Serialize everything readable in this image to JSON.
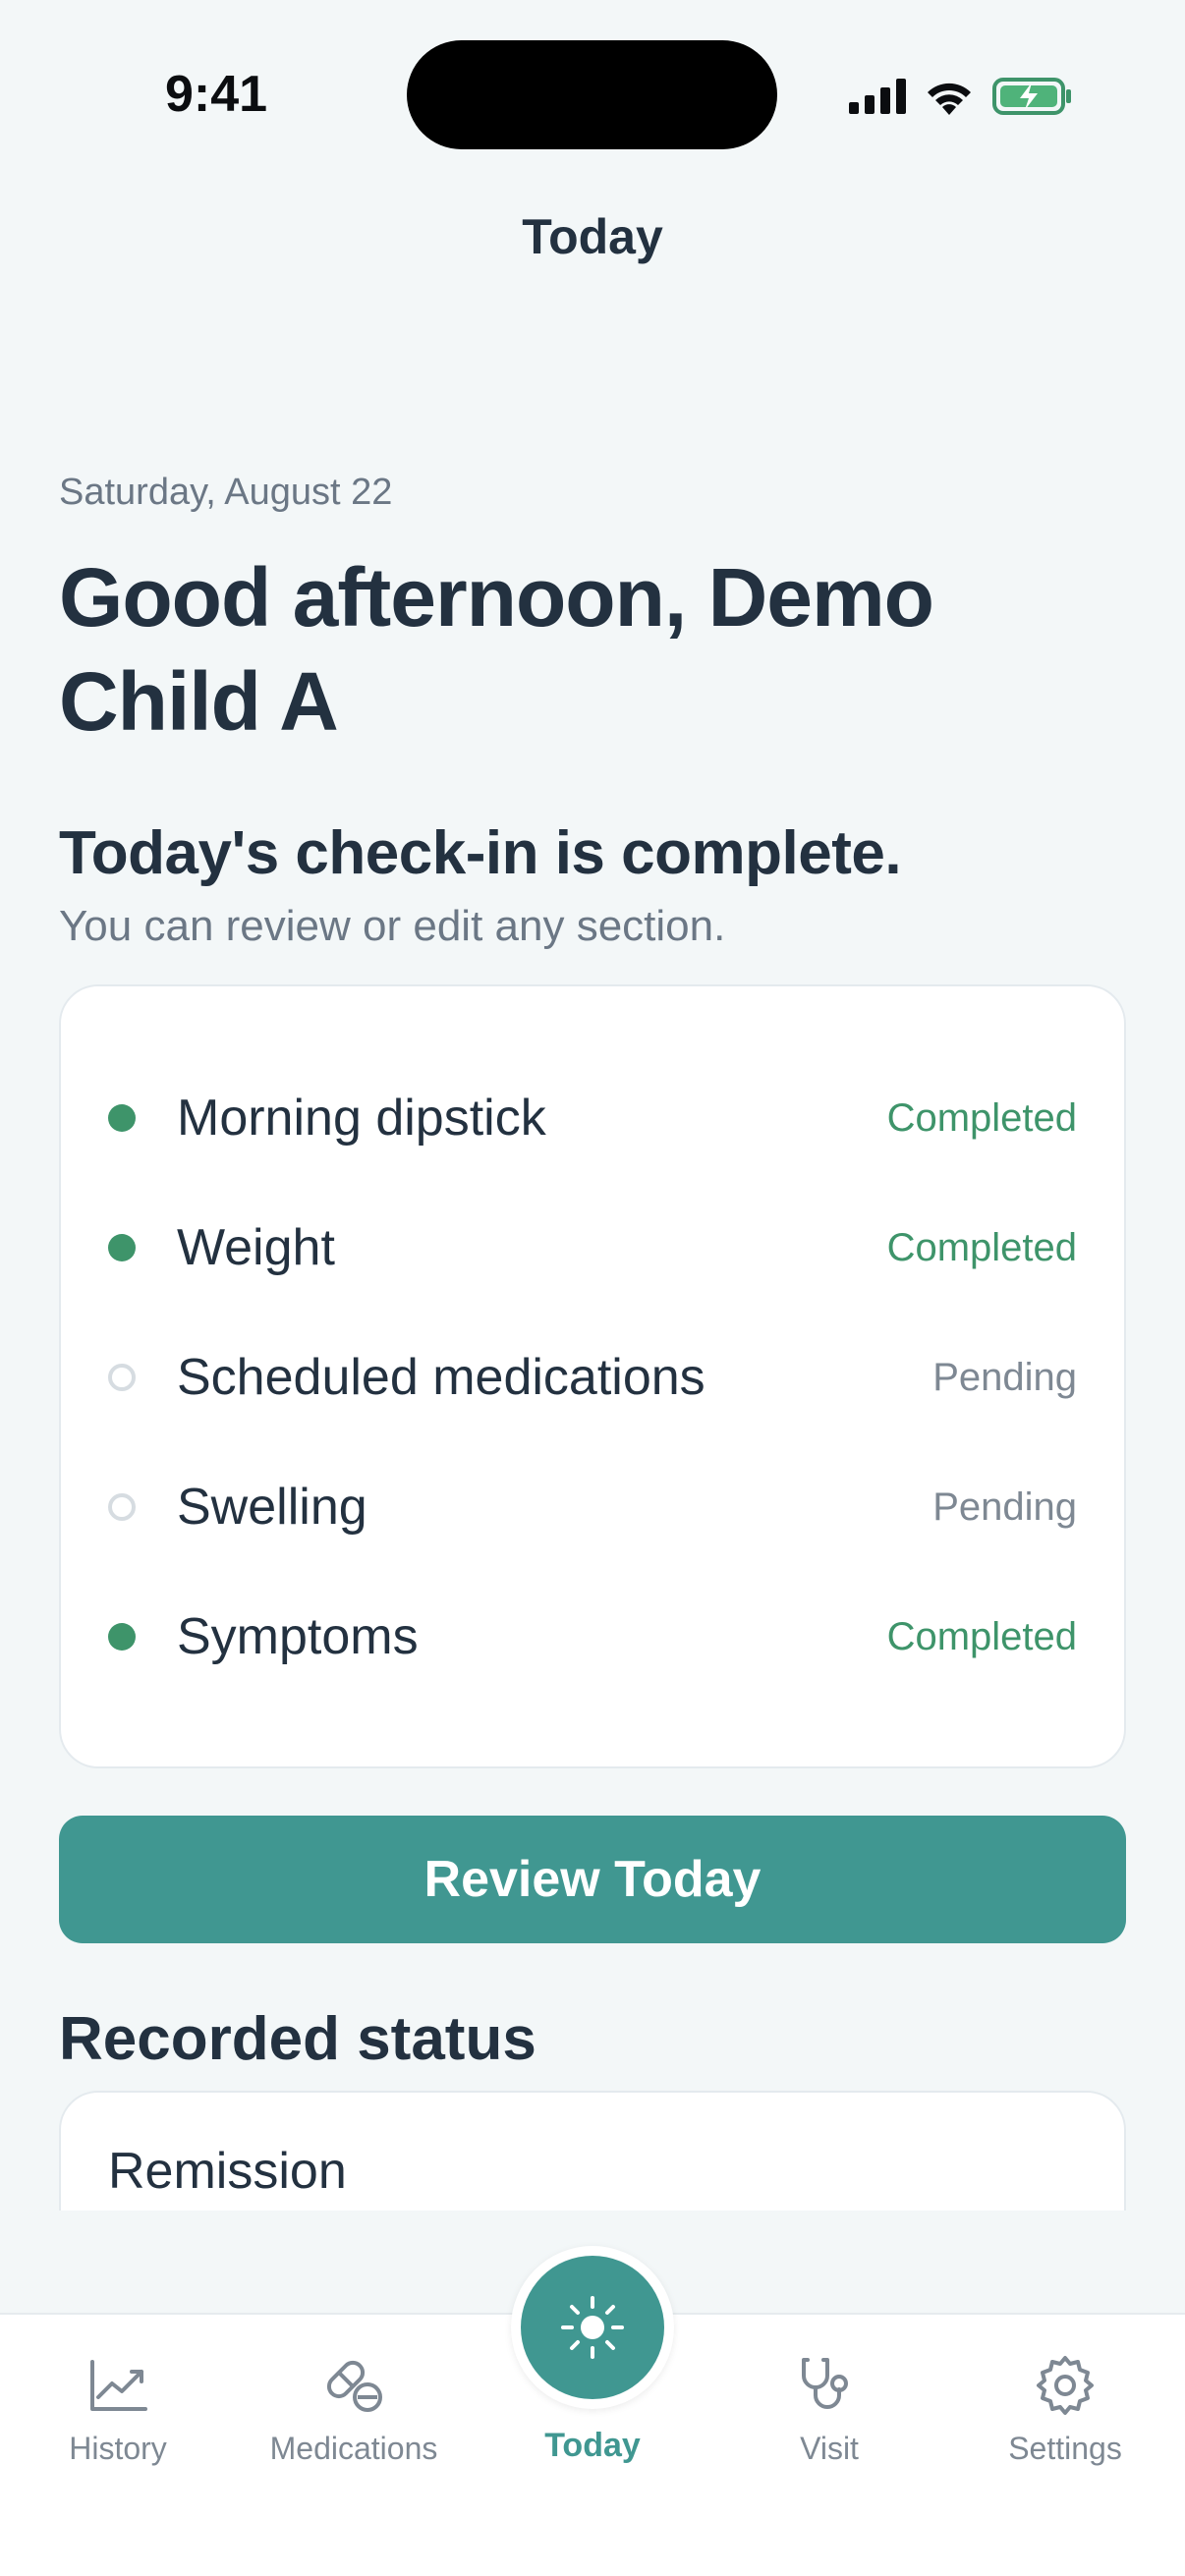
{
  "status_bar": {
    "time": "9:41"
  },
  "nav": {
    "title": "Today"
  },
  "header": {
    "date": "Saturday, August 22",
    "greeting": "Good afternoon, Demo Child A"
  },
  "checkin": {
    "title": "Today's check-in is complete.",
    "subtitle": "You can review or edit any section.",
    "tasks": [
      {
        "label": "Morning dipstick",
        "status": "Completed",
        "state": "done"
      },
      {
        "label": "Weight",
        "status": "Completed",
        "state": "done"
      },
      {
        "label": "Scheduled medications",
        "status": "Pending",
        "state": "pending"
      },
      {
        "label": "Swelling",
        "status": "Pending",
        "state": "pending"
      },
      {
        "label": "Symptoms",
        "status": "Completed",
        "state": "done"
      }
    ],
    "review_button": "Review Today"
  },
  "recorded": {
    "title": "Recorded status",
    "value": "Remission"
  },
  "tabbar": {
    "history": "History",
    "medications": "Medications",
    "today": "Today",
    "visit": "Visit",
    "settings": "Settings"
  },
  "colors": {
    "accent": "#409791",
    "completed": "#3E946A",
    "pending": "#7E8893",
    "background": "#F3F7F8"
  },
  "icons": {
    "history": "chart-line-icon",
    "medications": "pills-icon",
    "today": "sun-icon",
    "visit": "stethoscope-icon",
    "settings": "gear-icon"
  }
}
